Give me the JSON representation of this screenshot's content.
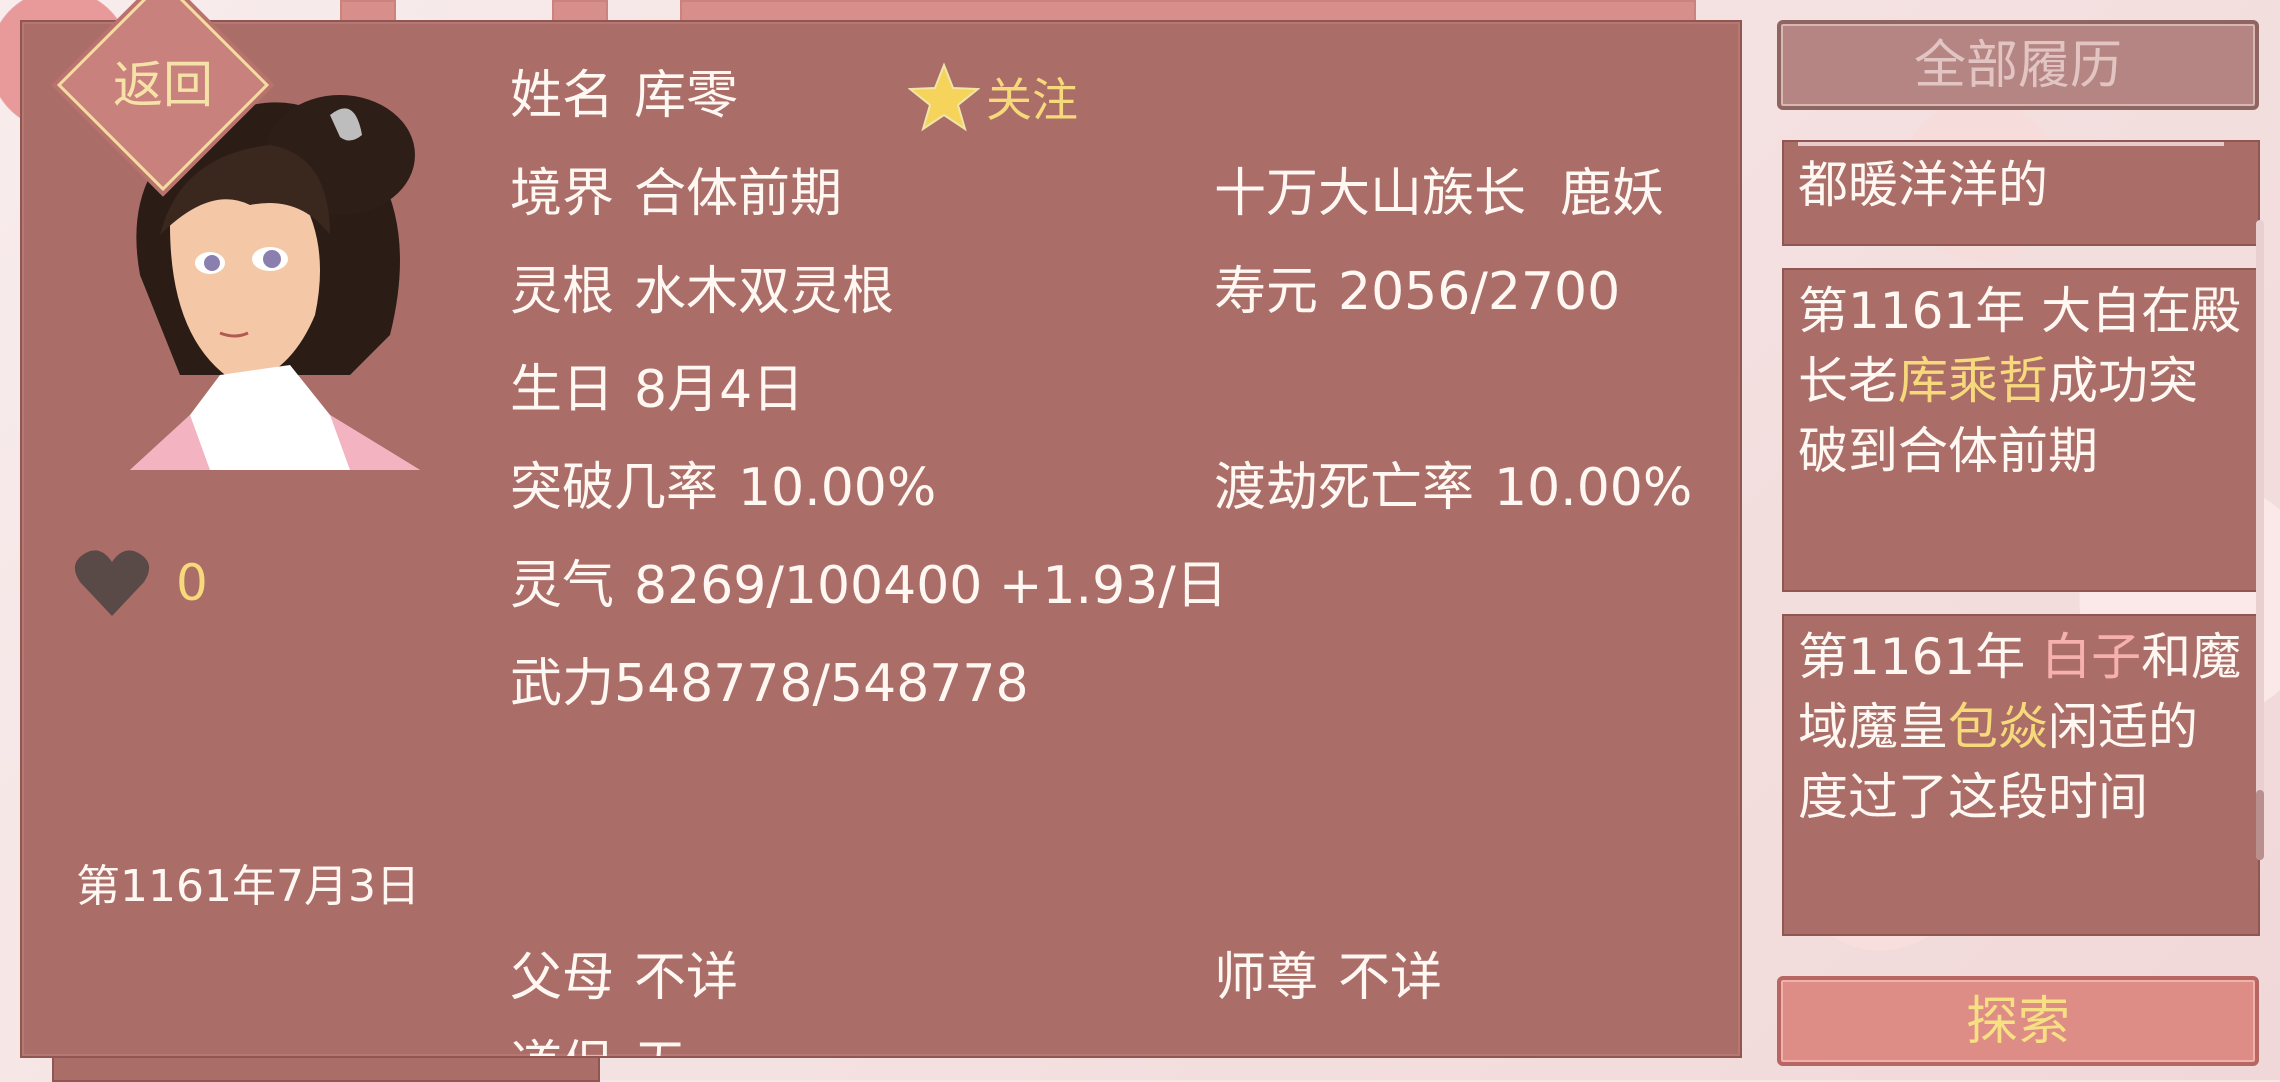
{
  "header": {
    "back_label": "返回",
    "follow_label": "关注"
  },
  "character": {
    "name_label": "姓名",
    "name": "库零",
    "realm_label": "境界",
    "realm": "合体前期",
    "title": "十万大山族长",
    "race": "鹿妖",
    "root_label": "灵根",
    "root": "水木双灵根",
    "lifespan_label": "寿元",
    "lifespan": "2056/2700",
    "birthday_label": "生日",
    "birthday": "8月4日",
    "breakthrough_label": "突破几率",
    "breakthrough": "10.00%",
    "tribulation_label": "渡劫死亡率",
    "tribulation": "10.00%",
    "qi_label": "灵气",
    "qi": "8269/100400 +1.93/日",
    "power_text": "武力548778/548778",
    "parents_label": "父母",
    "parents": "不详",
    "master_label": "师尊",
    "master": "不详",
    "partner_label_partial": "道侣",
    "partner_partial": "无"
  },
  "favor": {
    "count": "0"
  },
  "date": "第1161年7月3日",
  "sidebar": {
    "all_history_label": "全部履历",
    "explore_label": "探索",
    "entries": [
      {
        "parts": [
          {
            "text": "都暖洋洋的",
            "hl": ""
          }
        ]
      },
      {
        "parts": [
          {
            "text": "第1161年 大自在殿长老",
            "hl": ""
          },
          {
            "text": "库乘哲",
            "hl": "gold"
          },
          {
            "text": "成功突破到合体前期",
            "hl": ""
          }
        ]
      },
      {
        "parts": [
          {
            "text": "第1161年 ",
            "hl": ""
          },
          {
            "text": "白子",
            "hl": "pink"
          },
          {
            "text": "和魔域魔皇",
            "hl": ""
          },
          {
            "text": "包焱",
            "hl": "gold"
          },
          {
            "text": "闲适的度过了这段时间",
            "hl": ""
          }
        ]
      }
    ]
  },
  "colors": {
    "panel": "#ab6d68",
    "accent_gold": "#f6d97a",
    "accent_pink": "#f6b0ae",
    "explore_btn": "#de8c86"
  }
}
